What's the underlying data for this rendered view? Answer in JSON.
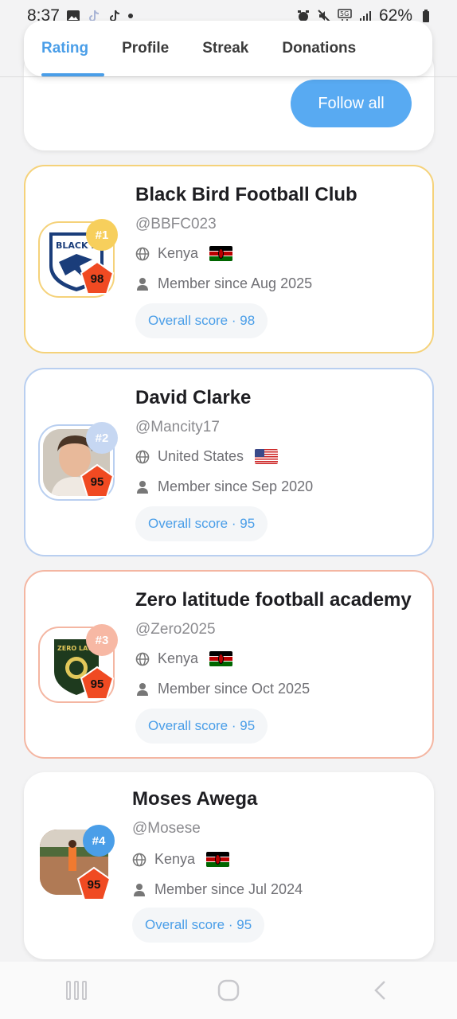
{
  "status_bar": {
    "time": "8:37",
    "battery": "62%"
  },
  "tabs": [
    {
      "label": "Rating",
      "active": true
    },
    {
      "label": "Profile",
      "active": false
    },
    {
      "label": "Streak",
      "active": false
    },
    {
      "label": "Donations",
      "active": false
    }
  ],
  "follow_all_label": "Follow all",
  "entries": [
    {
      "rank": "#1",
      "name": "Black Bird Football Club",
      "handle": "@BBFC023",
      "country": "Kenya",
      "member_since": "Member since Aug 2025",
      "score": "98",
      "overall": "Overall score · 98",
      "avatar_text": "BLACK BIRD",
      "theme": "#f5d27a"
    },
    {
      "rank": "#2",
      "name": "David Clarke",
      "handle": "@Mancity17",
      "country": "United States",
      "member_since": "Member since Sep 2020",
      "score": "95",
      "overall": "Overall score · 95",
      "theme": "#b9cff0"
    },
    {
      "rank": "#3",
      "name": "Zero latitude football academy",
      "handle": "@Zero2025",
      "country": "Kenya",
      "member_since": "Member since Oct 2025",
      "score": "95",
      "overall": "Overall score · 95",
      "avatar_text": "ZERO LATITUDE",
      "theme": "#f4b6a2"
    },
    {
      "rank": "#4",
      "name": "Moses Awega",
      "handle": "@Mosese",
      "country": "Kenya",
      "member_since": "Member since Jul 2024",
      "score": "95",
      "overall": "Overall score · 95",
      "theme": "#4a9ee8"
    }
  ],
  "icons": {
    "globe": "globe-icon",
    "person": "person-icon",
    "flag_kenya": "kenya-flag",
    "flag_us": "us-flag"
  },
  "colors": {
    "accent": "#4a9ee8",
    "score_badge": "#f04a22"
  }
}
